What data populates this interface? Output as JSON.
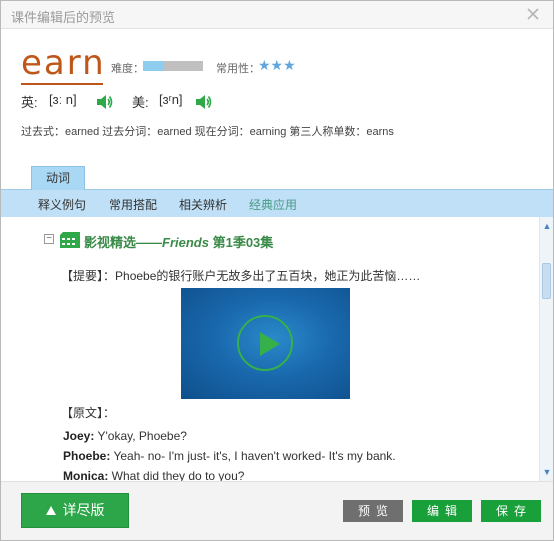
{
  "window": {
    "title": "课件编辑后的预览"
  },
  "word": {
    "text": "earn",
    "difficulty_label": "难度：",
    "difficulty_level": 0.33,
    "frequency_label": "常用性：",
    "frequency_stars": "★★★",
    "uk_label": "英:",
    "uk_phonetic": "[ɜː n]",
    "us_label": "美:",
    "us_phonetic": "[ɜʳn]",
    "forms": "过去式：earned 过去分词：earned 现在分词：earning 第三人称单数：earns"
  },
  "tabs": [
    {
      "label": "动词"
    }
  ],
  "subnav": [
    {
      "label": "释义例句"
    },
    {
      "label": "常用搭配"
    },
    {
      "label": "相关辨析"
    },
    {
      "label": "经典应用"
    }
  ],
  "section": {
    "collapse": "−",
    "title_prefix": "影视精选——",
    "title_show": "Friends",
    "title_suffix": " 第1季03集",
    "summary_label": "【提要】：",
    "summary_text": "Phoebe的银行账户无故多出了五百块，她正为此苦恼……",
    "original_label": "【原文】：",
    "dialogue": [
      {
        "speaker": "Joey:",
        "text": " Y'okay, Phoebe?"
      },
      {
        "speaker": "Phoebe:",
        "text": " Yeah- no- I'm just- it's, I haven't worked- It's my bank."
      },
      {
        "speaker": "Monica:",
        "text": " What did they do to you?"
      }
    ]
  },
  "footer": {
    "detail_label": "详尽版",
    "preview_label": "预览",
    "edit_label": "编辑",
    "save_label": "保存"
  },
  "colors": {
    "word": "#c0571a",
    "accent_green": "#19a03a",
    "tab_blue": "#bfe0f6",
    "difficulty_fill": "#8fcdef"
  }
}
